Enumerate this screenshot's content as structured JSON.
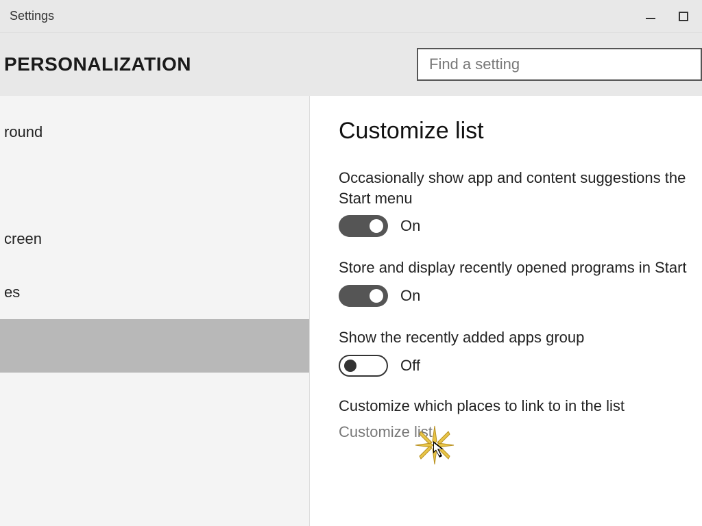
{
  "titlebar": {
    "title": "Settings"
  },
  "header": {
    "section": "PERSONALIZATION",
    "search_placeholder": "Find a setting"
  },
  "sidebar": {
    "items": [
      {
        "label": "round",
        "selected": false
      },
      {
        "label": "",
        "selected": false
      },
      {
        "label": "creen",
        "selected": false
      },
      {
        "label": "es",
        "selected": false
      },
      {
        "label": "",
        "selected": true
      }
    ]
  },
  "content": {
    "heading": "Customize list",
    "settings": [
      {
        "label": "Occasionally show app and content suggestions the Start menu",
        "state": "On",
        "on": true
      },
      {
        "label": "Store and display recently opened programs in Start",
        "state": "On",
        "on": true
      },
      {
        "label": "Show the recently added apps group",
        "state": "Off",
        "on": false
      }
    ],
    "link_section": {
      "heading": "Customize which places to link to in the list",
      "link": "Customize list"
    }
  }
}
